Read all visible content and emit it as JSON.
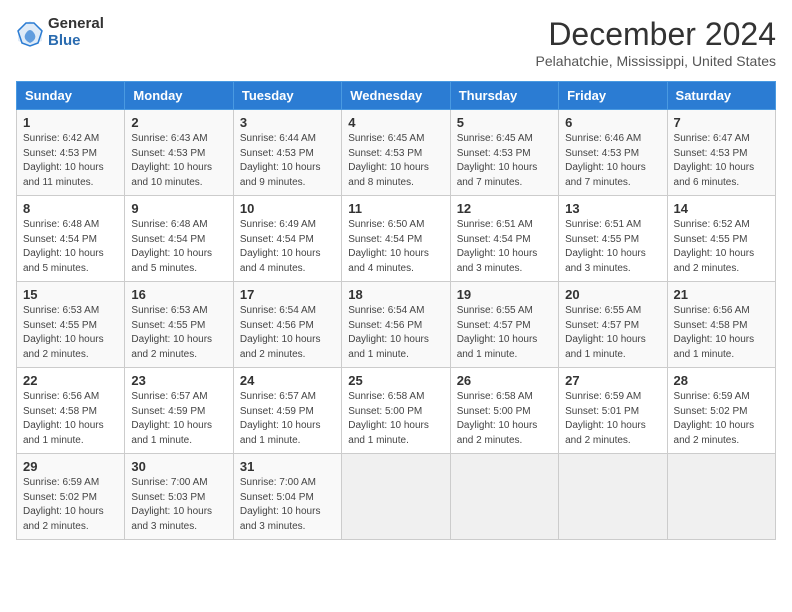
{
  "logo": {
    "general": "General",
    "blue": "Blue"
  },
  "title": "December 2024",
  "location": "Pelahatchie, Mississippi, United States",
  "headers": [
    "Sunday",
    "Monday",
    "Tuesday",
    "Wednesday",
    "Thursday",
    "Friday",
    "Saturday"
  ],
  "weeks": [
    [
      {
        "day": "1",
        "lines": [
          "Sunrise: 6:42 AM",
          "Sunset: 4:53 PM",
          "Daylight: 10 hours",
          "and 11 minutes."
        ]
      },
      {
        "day": "2",
        "lines": [
          "Sunrise: 6:43 AM",
          "Sunset: 4:53 PM",
          "Daylight: 10 hours",
          "and 10 minutes."
        ]
      },
      {
        "day": "3",
        "lines": [
          "Sunrise: 6:44 AM",
          "Sunset: 4:53 PM",
          "Daylight: 10 hours",
          "and 9 minutes."
        ]
      },
      {
        "day": "4",
        "lines": [
          "Sunrise: 6:45 AM",
          "Sunset: 4:53 PM",
          "Daylight: 10 hours",
          "and 8 minutes."
        ]
      },
      {
        "day": "5",
        "lines": [
          "Sunrise: 6:45 AM",
          "Sunset: 4:53 PM",
          "Daylight: 10 hours",
          "and 7 minutes."
        ]
      },
      {
        "day": "6",
        "lines": [
          "Sunrise: 6:46 AM",
          "Sunset: 4:53 PM",
          "Daylight: 10 hours",
          "and 7 minutes."
        ]
      },
      {
        "day": "7",
        "lines": [
          "Sunrise: 6:47 AM",
          "Sunset: 4:53 PM",
          "Daylight: 10 hours",
          "and 6 minutes."
        ]
      }
    ],
    [
      {
        "day": "8",
        "lines": [
          "Sunrise: 6:48 AM",
          "Sunset: 4:54 PM",
          "Daylight: 10 hours",
          "and 5 minutes."
        ]
      },
      {
        "day": "9",
        "lines": [
          "Sunrise: 6:48 AM",
          "Sunset: 4:54 PM",
          "Daylight: 10 hours",
          "and 5 minutes."
        ]
      },
      {
        "day": "10",
        "lines": [
          "Sunrise: 6:49 AM",
          "Sunset: 4:54 PM",
          "Daylight: 10 hours",
          "and 4 minutes."
        ]
      },
      {
        "day": "11",
        "lines": [
          "Sunrise: 6:50 AM",
          "Sunset: 4:54 PM",
          "Daylight: 10 hours",
          "and 4 minutes."
        ]
      },
      {
        "day": "12",
        "lines": [
          "Sunrise: 6:51 AM",
          "Sunset: 4:54 PM",
          "Daylight: 10 hours",
          "and 3 minutes."
        ]
      },
      {
        "day": "13",
        "lines": [
          "Sunrise: 6:51 AM",
          "Sunset: 4:55 PM",
          "Daylight: 10 hours",
          "and 3 minutes."
        ]
      },
      {
        "day": "14",
        "lines": [
          "Sunrise: 6:52 AM",
          "Sunset: 4:55 PM",
          "Daylight: 10 hours",
          "and 2 minutes."
        ]
      }
    ],
    [
      {
        "day": "15",
        "lines": [
          "Sunrise: 6:53 AM",
          "Sunset: 4:55 PM",
          "Daylight: 10 hours",
          "and 2 minutes."
        ]
      },
      {
        "day": "16",
        "lines": [
          "Sunrise: 6:53 AM",
          "Sunset: 4:55 PM",
          "Daylight: 10 hours",
          "and 2 minutes."
        ]
      },
      {
        "day": "17",
        "lines": [
          "Sunrise: 6:54 AM",
          "Sunset: 4:56 PM",
          "Daylight: 10 hours",
          "and 2 minutes."
        ]
      },
      {
        "day": "18",
        "lines": [
          "Sunrise: 6:54 AM",
          "Sunset: 4:56 PM",
          "Daylight: 10 hours",
          "and 1 minute."
        ]
      },
      {
        "day": "19",
        "lines": [
          "Sunrise: 6:55 AM",
          "Sunset: 4:57 PM",
          "Daylight: 10 hours",
          "and 1 minute."
        ]
      },
      {
        "day": "20",
        "lines": [
          "Sunrise: 6:55 AM",
          "Sunset: 4:57 PM",
          "Daylight: 10 hours",
          "and 1 minute."
        ]
      },
      {
        "day": "21",
        "lines": [
          "Sunrise: 6:56 AM",
          "Sunset: 4:58 PM",
          "Daylight: 10 hours",
          "and 1 minute."
        ]
      }
    ],
    [
      {
        "day": "22",
        "lines": [
          "Sunrise: 6:56 AM",
          "Sunset: 4:58 PM",
          "Daylight: 10 hours",
          "and 1 minute."
        ]
      },
      {
        "day": "23",
        "lines": [
          "Sunrise: 6:57 AM",
          "Sunset: 4:59 PM",
          "Daylight: 10 hours",
          "and 1 minute."
        ]
      },
      {
        "day": "24",
        "lines": [
          "Sunrise: 6:57 AM",
          "Sunset: 4:59 PM",
          "Daylight: 10 hours",
          "and 1 minute."
        ]
      },
      {
        "day": "25",
        "lines": [
          "Sunrise: 6:58 AM",
          "Sunset: 5:00 PM",
          "Daylight: 10 hours",
          "and 1 minute."
        ]
      },
      {
        "day": "26",
        "lines": [
          "Sunrise: 6:58 AM",
          "Sunset: 5:00 PM",
          "Daylight: 10 hours",
          "and 2 minutes."
        ]
      },
      {
        "day": "27",
        "lines": [
          "Sunrise: 6:59 AM",
          "Sunset: 5:01 PM",
          "Daylight: 10 hours",
          "and 2 minutes."
        ]
      },
      {
        "day": "28",
        "lines": [
          "Sunrise: 6:59 AM",
          "Sunset: 5:02 PM",
          "Daylight: 10 hours",
          "and 2 minutes."
        ]
      }
    ],
    [
      {
        "day": "29",
        "lines": [
          "Sunrise: 6:59 AM",
          "Sunset: 5:02 PM",
          "Daylight: 10 hours",
          "and 2 minutes."
        ]
      },
      {
        "day": "30",
        "lines": [
          "Sunrise: 7:00 AM",
          "Sunset: 5:03 PM",
          "Daylight: 10 hours",
          "and 3 minutes."
        ]
      },
      {
        "day": "31",
        "lines": [
          "Sunrise: 7:00 AM",
          "Sunset: 5:04 PM",
          "Daylight: 10 hours",
          "and 3 minutes."
        ]
      },
      {
        "day": "",
        "lines": []
      },
      {
        "day": "",
        "lines": []
      },
      {
        "day": "",
        "lines": []
      },
      {
        "day": "",
        "lines": []
      }
    ]
  ]
}
